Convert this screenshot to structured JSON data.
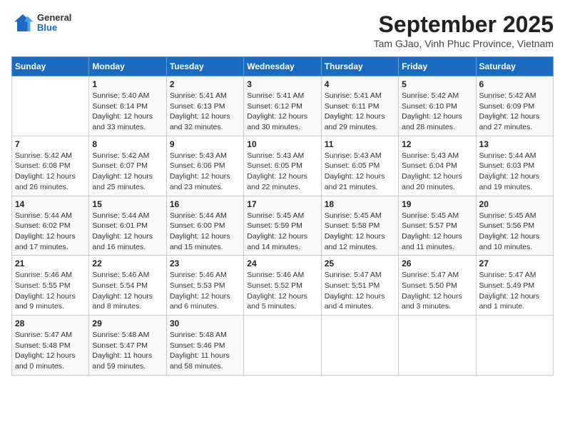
{
  "header": {
    "logo_general": "General",
    "logo_blue": "Blue",
    "title": "September 2025",
    "subtitle": "Tam GJao, Vinh Phuc Province, Vietnam"
  },
  "days_of_week": [
    "Sunday",
    "Monday",
    "Tuesday",
    "Wednesday",
    "Thursday",
    "Friday",
    "Saturday"
  ],
  "weeks": [
    [
      {
        "day": "",
        "info": ""
      },
      {
        "day": "1",
        "info": "Sunrise: 5:40 AM\nSunset: 6:14 PM\nDaylight: 12 hours\nand 33 minutes."
      },
      {
        "day": "2",
        "info": "Sunrise: 5:41 AM\nSunset: 6:13 PM\nDaylight: 12 hours\nand 32 minutes."
      },
      {
        "day": "3",
        "info": "Sunrise: 5:41 AM\nSunset: 6:12 PM\nDaylight: 12 hours\nand 30 minutes."
      },
      {
        "day": "4",
        "info": "Sunrise: 5:41 AM\nSunset: 6:11 PM\nDaylight: 12 hours\nand 29 minutes."
      },
      {
        "day": "5",
        "info": "Sunrise: 5:42 AM\nSunset: 6:10 PM\nDaylight: 12 hours\nand 28 minutes."
      },
      {
        "day": "6",
        "info": "Sunrise: 5:42 AM\nSunset: 6:09 PM\nDaylight: 12 hours\nand 27 minutes."
      }
    ],
    [
      {
        "day": "7",
        "info": "Sunrise: 5:42 AM\nSunset: 6:08 PM\nDaylight: 12 hours\nand 26 minutes."
      },
      {
        "day": "8",
        "info": "Sunrise: 5:42 AM\nSunset: 6:07 PM\nDaylight: 12 hours\nand 25 minutes."
      },
      {
        "day": "9",
        "info": "Sunrise: 5:43 AM\nSunset: 6:06 PM\nDaylight: 12 hours\nand 23 minutes."
      },
      {
        "day": "10",
        "info": "Sunrise: 5:43 AM\nSunset: 6:05 PM\nDaylight: 12 hours\nand 22 minutes."
      },
      {
        "day": "11",
        "info": "Sunrise: 5:43 AM\nSunset: 6:05 PM\nDaylight: 12 hours\nand 21 minutes."
      },
      {
        "day": "12",
        "info": "Sunrise: 5:43 AM\nSunset: 6:04 PM\nDaylight: 12 hours\nand 20 minutes."
      },
      {
        "day": "13",
        "info": "Sunrise: 5:44 AM\nSunset: 6:03 PM\nDaylight: 12 hours\nand 19 minutes."
      }
    ],
    [
      {
        "day": "14",
        "info": "Sunrise: 5:44 AM\nSunset: 6:02 PM\nDaylight: 12 hours\nand 17 minutes."
      },
      {
        "day": "15",
        "info": "Sunrise: 5:44 AM\nSunset: 6:01 PM\nDaylight: 12 hours\nand 16 minutes."
      },
      {
        "day": "16",
        "info": "Sunrise: 5:44 AM\nSunset: 6:00 PM\nDaylight: 12 hours\nand 15 minutes."
      },
      {
        "day": "17",
        "info": "Sunrise: 5:45 AM\nSunset: 5:59 PM\nDaylight: 12 hours\nand 14 minutes."
      },
      {
        "day": "18",
        "info": "Sunrise: 5:45 AM\nSunset: 5:58 PM\nDaylight: 12 hours\nand 12 minutes."
      },
      {
        "day": "19",
        "info": "Sunrise: 5:45 AM\nSunset: 5:57 PM\nDaylight: 12 hours\nand 11 minutes."
      },
      {
        "day": "20",
        "info": "Sunrise: 5:45 AM\nSunset: 5:56 PM\nDaylight: 12 hours\nand 10 minutes."
      }
    ],
    [
      {
        "day": "21",
        "info": "Sunrise: 5:46 AM\nSunset: 5:55 PM\nDaylight: 12 hours\nand 9 minutes."
      },
      {
        "day": "22",
        "info": "Sunrise: 5:46 AM\nSunset: 5:54 PM\nDaylight: 12 hours\nand 8 minutes."
      },
      {
        "day": "23",
        "info": "Sunrise: 5:46 AM\nSunset: 5:53 PM\nDaylight: 12 hours\nand 6 minutes."
      },
      {
        "day": "24",
        "info": "Sunrise: 5:46 AM\nSunset: 5:52 PM\nDaylight: 12 hours\nand 5 minutes."
      },
      {
        "day": "25",
        "info": "Sunrise: 5:47 AM\nSunset: 5:51 PM\nDaylight: 12 hours\nand 4 minutes."
      },
      {
        "day": "26",
        "info": "Sunrise: 5:47 AM\nSunset: 5:50 PM\nDaylight: 12 hours\nand 3 minutes."
      },
      {
        "day": "27",
        "info": "Sunrise: 5:47 AM\nSunset: 5:49 PM\nDaylight: 12 hours\nand 1 minute."
      }
    ],
    [
      {
        "day": "28",
        "info": "Sunrise: 5:47 AM\nSunset: 5:48 PM\nDaylight: 12 hours\nand 0 minutes."
      },
      {
        "day": "29",
        "info": "Sunrise: 5:48 AM\nSunset: 5:47 PM\nDaylight: 11 hours\nand 59 minutes."
      },
      {
        "day": "30",
        "info": "Sunrise: 5:48 AM\nSunset: 5:46 PM\nDaylight: 11 hours\nand 58 minutes."
      },
      {
        "day": "",
        "info": ""
      },
      {
        "day": "",
        "info": ""
      },
      {
        "day": "",
        "info": ""
      },
      {
        "day": "",
        "info": ""
      }
    ]
  ]
}
